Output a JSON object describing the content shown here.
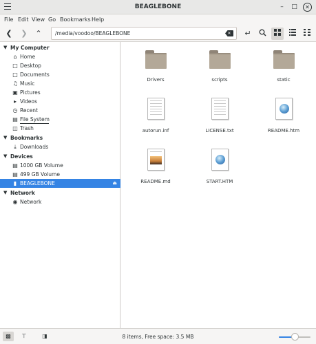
{
  "window": {
    "title": "BEAGLEBONE",
    "minimize": "–",
    "maximize": "□",
    "close": "✕"
  },
  "menubar": {
    "items": [
      "File",
      "Edit",
      "View",
      "Go",
      "Bookmarks",
      "Help"
    ]
  },
  "toolbar": {
    "location": "/media/voodoo/BEAGLEBONE",
    "icons": [
      "back-arrow-icon",
      "forward-arrow-icon",
      "up-arrow-icon",
      "backspace-clear-icon",
      "reload-icon",
      "search-icon",
      "icon-view-icon",
      "list-view-icon",
      "compact-view-icon"
    ]
  },
  "sidebar": {
    "sections": [
      {
        "label": "My Computer",
        "items": [
          {
            "label": "Home",
            "icon": "home-icon"
          },
          {
            "label": "Desktop",
            "icon": "folder-icon"
          },
          {
            "label": "Documents",
            "icon": "folder-icon"
          },
          {
            "label": "Music",
            "icon": "music-icon"
          },
          {
            "label": "Pictures",
            "icon": "pictures-icon"
          },
          {
            "label": "Videos",
            "icon": "videos-icon"
          },
          {
            "label": "Recent",
            "icon": "recent-icon"
          },
          {
            "label": "File System",
            "icon": "drive-icon"
          },
          {
            "label": "Trash",
            "icon": "trash-icon"
          }
        ]
      },
      {
        "label": "Bookmarks",
        "items": [
          {
            "label": "Downloads",
            "icon": "download-icon"
          }
        ]
      },
      {
        "label": "Devices",
        "items": [
          {
            "label": "1000 GB Volume",
            "icon": "drive-icon"
          },
          {
            "label": "499 GB Volume",
            "icon": "drive-icon"
          },
          {
            "label": "BEAGLEBONE",
            "icon": "usb-icon",
            "selected": true
          }
        ]
      },
      {
        "label": "Network",
        "items": [
          {
            "label": "Network",
            "icon": "network-icon"
          }
        ]
      }
    ]
  },
  "files": [
    {
      "name": "Drivers",
      "kind": "folder"
    },
    {
      "name": "scripts",
      "kind": "folder"
    },
    {
      "name": "static",
      "kind": "folder"
    },
    {
      "name": "autorun.inf",
      "kind": "text"
    },
    {
      "name": "LICENSE.txt",
      "kind": "text"
    },
    {
      "name": "README.htm",
      "kind": "html"
    },
    {
      "name": "README.md",
      "kind": "image-doc"
    },
    {
      "name": "START.HTM",
      "kind": "html"
    }
  ],
  "statusbar": {
    "text": "8 items, Free space: 3.5 MB",
    "zoom_fraction": 0.5
  },
  "colors": {
    "selection": "#3584e4",
    "folder": "#b3a898"
  }
}
